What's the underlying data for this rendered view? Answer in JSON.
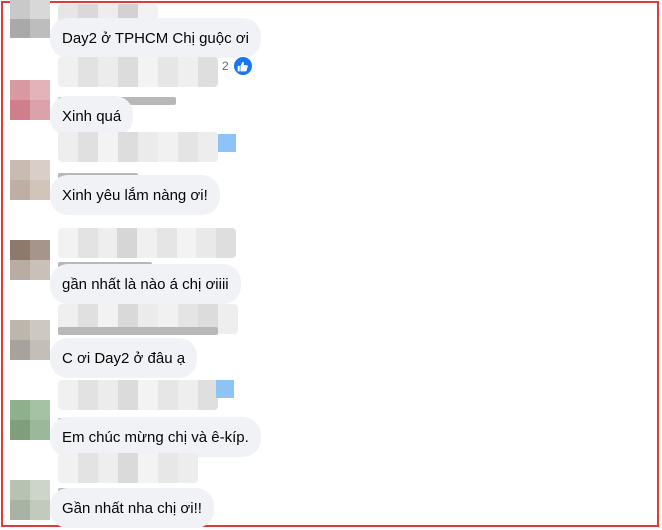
{
  "comments": [
    {
      "text": "Day2 ở TPHCM Chị guộc ơi"
    },
    {
      "text": "Xinh quá",
      "reaction_count": "2"
    },
    {
      "text": "Xinh yêu lắm nàng ơi!"
    },
    {
      "text": "gần nhất là nào á chị ơiiii"
    },
    {
      "text": "C ơi Day2 ở đâu ạ"
    },
    {
      "text": "Em chúc mừng chị và ê-kíp."
    },
    {
      "text": "Gần nhất nha chị ơi!!"
    }
  ],
  "icons": {
    "reaction": "like-icon"
  },
  "colors": {
    "accent": "#1877f2",
    "frame": "#e23a3a",
    "bubble": "#f0f2f5"
  }
}
